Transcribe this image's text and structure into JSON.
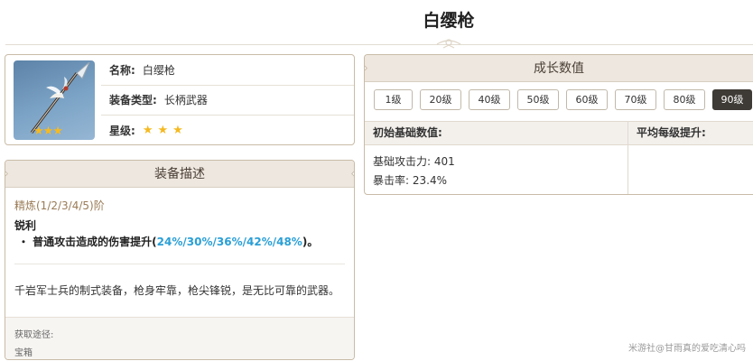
{
  "page": {
    "title": "白缨枪"
  },
  "info": {
    "name_label": "名称:",
    "name_value": "白缨枪",
    "type_label": "装备类型:",
    "type_value": "长柄武器",
    "rarity_label": "星级:",
    "rarity_stars": 3,
    "image_stars": "★★★"
  },
  "description": {
    "header": "装备描述",
    "refinement": "精炼(1/2/3/4/5)阶",
    "passive_name": "锐利",
    "passive_prefix": "・ 普通攻击造成的伤害提升(",
    "passive_values": "24%/30%/36%/42%/48%",
    "passive_suffix": ")。",
    "lore": "千岩军士兵的制式装备，枪身牢靠，枪尖锋锐，是无比可靠的武器。",
    "source_label": "获取途径:",
    "source_value": "宝箱"
  },
  "growth": {
    "header": "成长数值",
    "levels": [
      "1级",
      "20级",
      "40级",
      "50级",
      "60级",
      "70级",
      "80级",
      "90级"
    ],
    "active_level": "90级",
    "col_base": "初始基础数值:",
    "col_per_level": "平均每级提升:",
    "stat_atk": "基础攻击力: 401",
    "stat_crit": "暴击率: 23.4%"
  },
  "watermark": "米游社@甘雨真的爱吃清心吗",
  "colors": {
    "header_bg": "#ede7df",
    "border": "#c9bba7",
    "highlight": "#2a9fd6",
    "star": "#f5b921",
    "active_btn": "#3e3a35"
  }
}
